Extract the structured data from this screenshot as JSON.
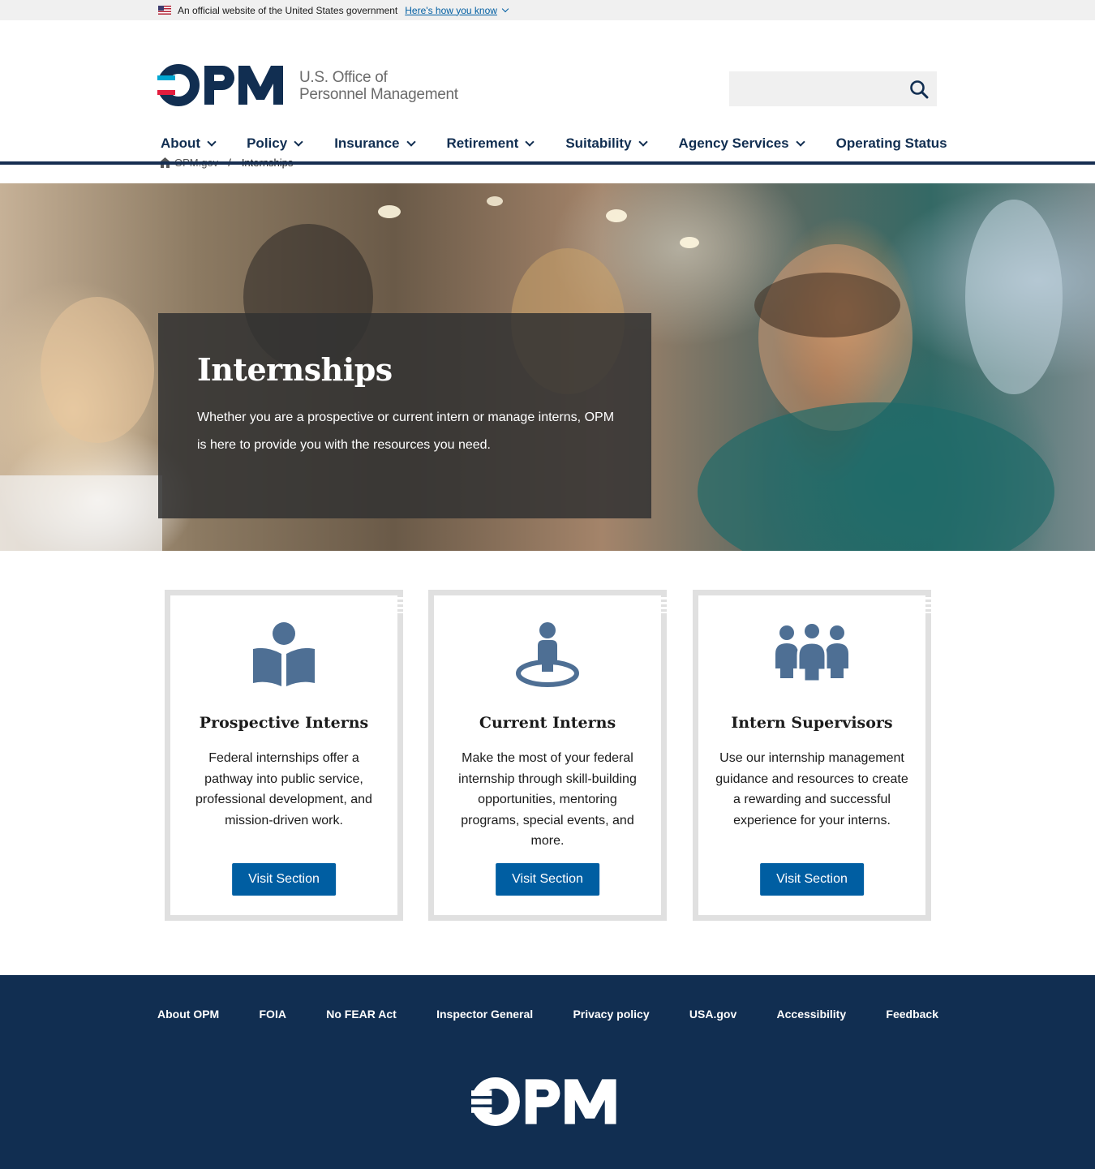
{
  "banner": {
    "text": "An official website of the United States government",
    "link": "Here's how you know"
  },
  "header": {
    "logo_letters": "OPM",
    "org_line1": "U.S. Office of",
    "org_line2": "Personnel Management",
    "search_placeholder": ""
  },
  "nav": {
    "items": [
      {
        "label": "About",
        "dropdown": true
      },
      {
        "label": "Policy",
        "dropdown": true
      },
      {
        "label": "Insurance",
        "dropdown": true
      },
      {
        "label": "Retirement",
        "dropdown": true
      },
      {
        "label": "Suitability",
        "dropdown": true
      },
      {
        "label": "Agency Services",
        "dropdown": true
      },
      {
        "label": "Operating Status",
        "dropdown": false
      }
    ]
  },
  "breadcrumb": {
    "home": "OPM.gov",
    "separator": "/",
    "current": "Internships"
  },
  "hero": {
    "title": "Internships",
    "description": "Whether you are a prospective or current intern or manage interns, OPM is here to provide you with the resources you need."
  },
  "cards": [
    {
      "icon": "book-reader-icon",
      "title": "Prospective Interns",
      "description": "Federal internships offer a pathway into public service, professional development, and mission-driven work.",
      "button": "Visit Section"
    },
    {
      "icon": "person-location-icon",
      "title": "Current Interns",
      "description": "Make the most of your federal internship through skill-building opportunities, mentoring programs, special events, and more.",
      "button": "Visit Section"
    },
    {
      "icon": "group-icon",
      "title": "Intern Supervisors",
      "description": "Use our internship management guidance and resources to create a rewarding and successful experience for your interns.",
      "button": "Visit Section"
    }
  ],
  "footer": {
    "links": [
      "About OPM",
      "FOIA",
      "No FEAR Act",
      "Inspector General",
      "Privacy policy",
      "USA.gov",
      "Accessibility",
      "Feedback"
    ],
    "logo_letters": "OPM"
  },
  "colors": {
    "navy": "#112e51",
    "primary_blue": "#005ea2",
    "icon_blue": "#4e6f94",
    "logo_red": "#e31c3d",
    "logo_light_blue": "#00a6d2"
  }
}
